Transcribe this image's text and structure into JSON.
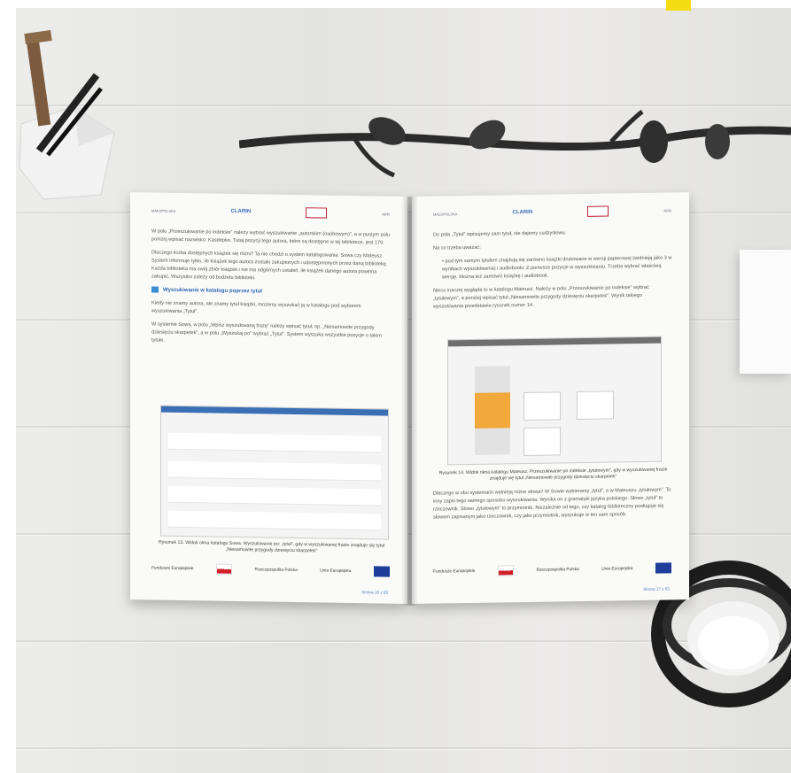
{
  "scene": {
    "colors": {
      "accent_yellow": "#f4dd12",
      "heading_blue": "#2d66b0"
    }
  },
  "left_page": {
    "header_logos": [
      "MAŁOPOLSKA",
      "CLARIN",
      "FRDL",
      "NPR"
    ],
    "paragraphs": [
      "W polu „Przeszukiwanie po indeksie” należy wybrać wyszukiwanie „autorskim (osobowym)”, a w pustym polu poniżej wpisać nazwisko: Kasdepke. Tutaj pozycji tego autora, które są dostępne w tej bibliotece, jest 179.",
      "Dlaczego liczba dostępnych książek się różni? Ta nie chodzi o system katalogowania: Sowa czy Mateusz. System informuje tylko, ile książek tego autora zostało zakupionych i udostępnionych przez daną bibliotekę. Każda biblioteka ma swój zbiór książek i nie ma odgórnych ustaleń, ile książek danego autora powinna zakupić. Wszystko zależy od budżetu biblioteki."
    ],
    "heading": "Wyszukiwanie w katalogu poprzez tytuł",
    "paragraphs2": [
      "Kiedy nie znamy autora, ale znamy tytuł książki, możemy wyszukać ją w katalogu pod wyborem wyszukiwania „Tytuł”.",
      "W systemie Sowa, w polu „Wpisz wyszukiwaną frazę” należy wpisać tytuł, np. „Niesamowite przygody dziesięciu skarpetek”, a w polu „Wyszukaj po” wybrać „Tytuł”. System wyszuka wszystkie pozycje o takim tytule."
    ],
    "caption": "Rysunek 13. Widok okna katalogu Sowa. Wyszukiwanie po: „tytuł”, gdy w wyszukiwanej frazie znajduje się tytuł „Niesamowite przygody dziesięciu skarpetek”",
    "footer": {
      "left": "Fundusze Europejskie",
      "mid": "Rzeczpospolita Polska",
      "right": "Unia Europejska"
    },
    "page_number": "Strona 16 z 63"
  },
  "right_page": {
    "header_logos": [
      "MAŁOPOLSKA",
      "CLARIN",
      "FRDL",
      "NPR"
    ],
    "intro": "Do pola „Tytuł” wpisujemy sam tytuł, nie dajemy cudzysłowu.",
    "note_label": "Na co trzeba uważać:",
    "bullet": "pod tym samym tytułem znajdują się zarówno książki drukowane w wersji papierowej (widnieją jako 3 w wynikach wyszukiwania) i audiobooki. Z pierwsze pozycje w wyszukiwaniu. Trzeba wybrać właściwą wersję. Można też zamówić książkę i audiobook.",
    "para": "Nieco inaczej wygląda to w katalogu Mateusz. Należy w polu „Przeszukiwanie po indeksie” wybrać „tytułowym”, a poniżej wpisać tytuł „Niesamowite przygody dziesięciu skarpetek”. Wynik takiego wyszukiwania przedstawia rysunek numer 14.",
    "caption": "Rysunek 14. Widok okna katalogu Mateusz. Przeszukiwanie po indeksie „tytułowym”, gdy w wyszukiwanej frazie znajduje się tytuł „Niesamowite przygody dziesięciu skarpetek”",
    "closing": "Dlaczego w obu systemach widnieją różne słowa? W Sowie wybieramy „tytuł”, a w Mateuszu „tytułowym”. To inny zapis tego samego sposobu wyszukiwania. Wynika on z gramatyki języka polskiego. Słowo „tytuł” to rzeczownik. Słowo „tytułowym” to przymiotnik. Niezależnie od tego, czy katalog biblioteczny posługuje się słowem zapisanym jako rzeczownik, czy jako przymiotnik, wyszukuje w ten sam sposób.",
    "footer": {
      "left": "Fundusze Europejskie",
      "mid": "Rzeczpospolita Polska",
      "right": "Unia Europejska"
    },
    "page_number": "Strona 17 z 63"
  }
}
